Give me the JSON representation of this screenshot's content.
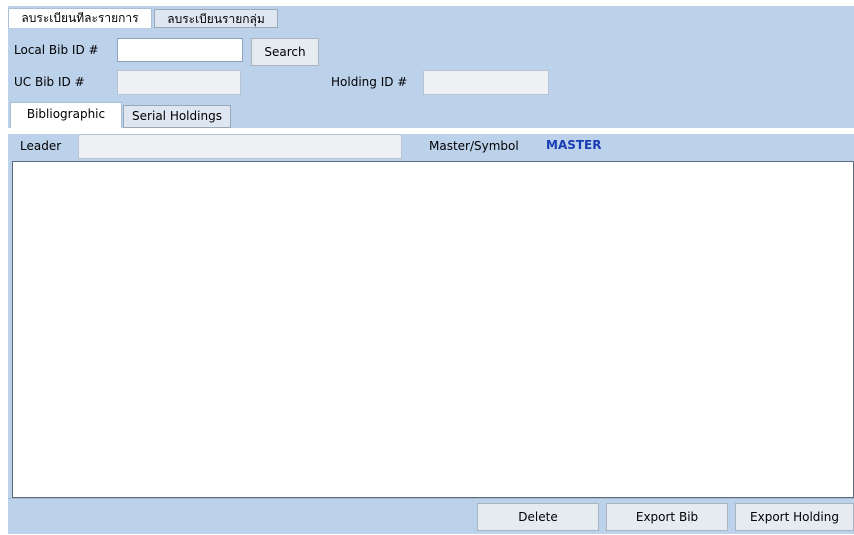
{
  "top_tabs": {
    "individual": "ลบระเบียนทีละรายการ",
    "group": "ลบระเบียนรายกลุ่ม"
  },
  "search_row": {
    "local_bib_label": "Local Bib ID #",
    "local_bib_value": "",
    "search_button": "Search"
  },
  "id_row": {
    "uc_bib_label": "UC Bib ID #",
    "uc_bib_value": "",
    "holding_label": "Holding ID #",
    "holding_value": ""
  },
  "inner_tabs": {
    "bibliographic": "Bibliographic",
    "serial_holdings": "Serial Holdings"
  },
  "leader_row": {
    "leader_label": "Leader",
    "leader_value": "",
    "master_symbol_label": "Master/Symbol",
    "master_symbol_value": "MASTER"
  },
  "record_content": "",
  "actions": {
    "delete": "Delete",
    "export_bib": "Export Bib",
    "export_holding": "Export Holding"
  },
  "colors": {
    "panel_bg": "#bcd1ea",
    "master_text": "#1a3db5"
  }
}
